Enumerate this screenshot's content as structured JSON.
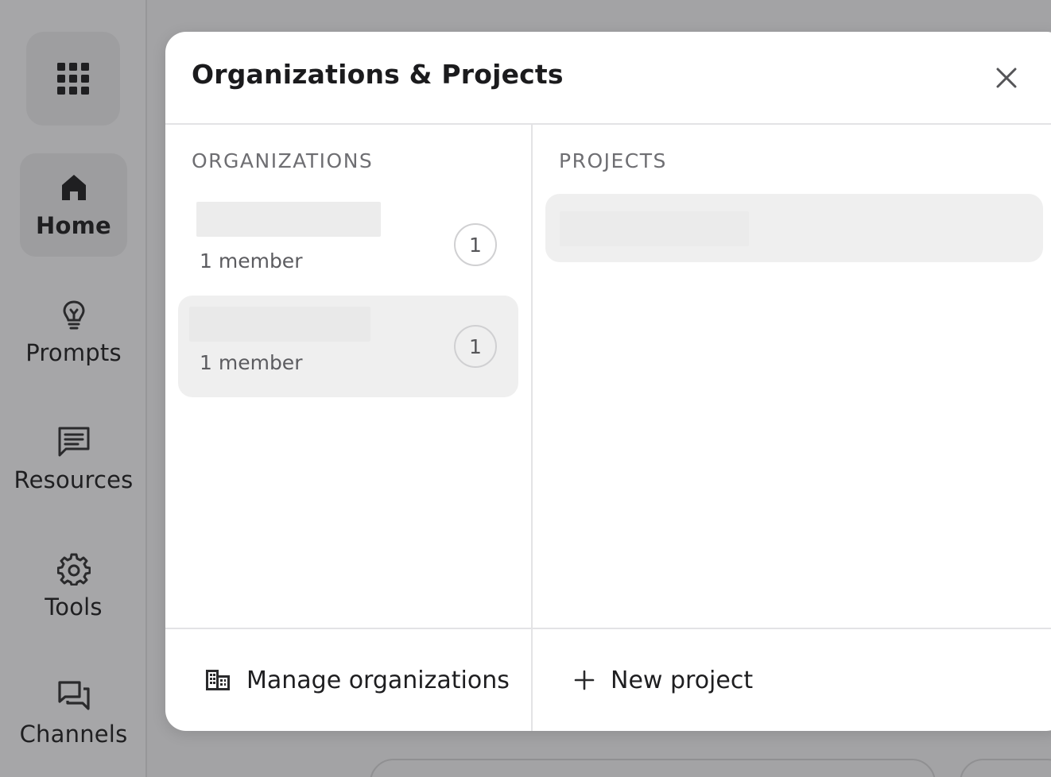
{
  "sidebar": {
    "apps_icon": "grid-icon",
    "items": [
      {
        "label": "Home",
        "icon": "home-icon",
        "active": true
      },
      {
        "label": "Prompts",
        "icon": "lightbulb-icon",
        "active": false
      },
      {
        "label": "Resources",
        "icon": "message-icon",
        "active": false
      },
      {
        "label": "Tools",
        "icon": "gear-icon",
        "active": false
      },
      {
        "label": "Channels",
        "icon": "chat-icon",
        "active": false
      }
    ]
  },
  "modal": {
    "title": "Organizations & Projects",
    "close_icon": "close-icon",
    "organizations": {
      "heading": "ORGANIZATIONS",
      "items": [
        {
          "members": "1 member",
          "count": "1",
          "selected": false
        },
        {
          "members": "1 member",
          "count": "1",
          "selected": true
        }
      ]
    },
    "projects": {
      "heading": "PROJECTS"
    },
    "footer": {
      "manage_label": "Manage organizations",
      "manage_icon": "building-icon",
      "new_project_label": "New project",
      "new_project_icon": "plus-icon"
    }
  },
  "colors": {
    "backdrop": "#a3a3a5",
    "modal_bg": "#ffffff",
    "selected_bg": "#efefef",
    "heading_text": "#6e6e72"
  }
}
